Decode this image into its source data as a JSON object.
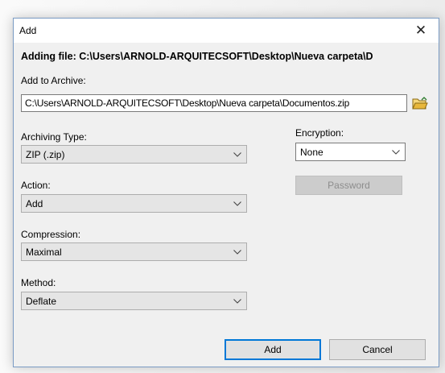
{
  "window": {
    "title": "Add",
    "close_glyph": "✕"
  },
  "adding_file": "Adding file: C:\\Users\\ARNOLD-ARQUITECSOFT\\Desktop\\Nueva carpeta\\D",
  "archive": {
    "label": "Add to Archive:",
    "value": "C:\\Users\\ARNOLD-ARQUITECSOFT\\Desktop\\Nueva carpeta\\Documentos.zip",
    "browse_icon": "folder-open-icon"
  },
  "archiving_type": {
    "label": "Archiving Type:",
    "value": "ZIP (.zip)"
  },
  "action": {
    "label": "Action:",
    "value": "Add"
  },
  "compression": {
    "label": "Compression:",
    "value": "Maximal"
  },
  "method": {
    "label": "Method:",
    "value": "Deflate"
  },
  "encryption": {
    "label": "Encryption:",
    "value": "None",
    "password_label": "Password"
  },
  "buttons": {
    "add": "Add",
    "cancel": "Cancel"
  },
  "colors": {
    "accent": "#0078d7",
    "folder": "#e8b73b"
  }
}
